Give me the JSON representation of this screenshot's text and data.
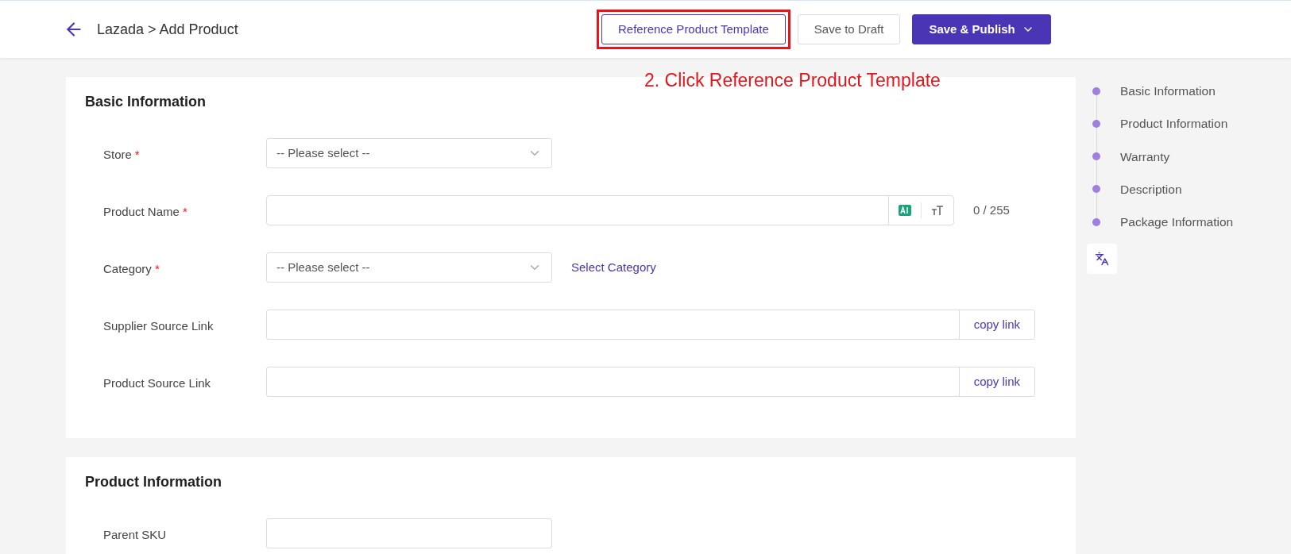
{
  "header": {
    "title": "Lazada > Add Product",
    "buttons": [
      {
        "label": "Reference Product Template",
        "kind": "outline",
        "highlighted": true
      },
      {
        "label": "Save to Draft",
        "kind": "plain",
        "highlighted": false
      },
      {
        "label": "Save & Publish",
        "kind": "primary",
        "highlighted": false
      }
    ]
  },
  "annotation": {
    "text": "2. Click Reference Product Template"
  },
  "sections": [
    {
      "title": "Basic Information",
      "fields": [
        {
          "label": "Store",
          "required_mark": "*",
          "kind": "select",
          "placeholder": "-- Please select --"
        },
        {
          "label": "Product Name",
          "required_mark": "*",
          "kind": "text-ai",
          "counter": "0 / 255"
        },
        {
          "label": "Category",
          "required_mark": "*",
          "kind": "select",
          "placeholder": "-- Please select --",
          "link": "Select Category"
        },
        {
          "label": "Supplier Source Link",
          "kind": "link-input",
          "button": "copy link"
        },
        {
          "label": "Product Source Link",
          "kind": "link-input",
          "button": "copy link"
        }
      ]
    },
    {
      "title": "Product Information",
      "fields": [
        {
          "label": "Parent SKU",
          "kind": "text"
        }
      ]
    }
  ],
  "nav": [
    {
      "label": "Basic Information"
    },
    {
      "label": "Product Information"
    },
    {
      "label": "Warranty"
    },
    {
      "label": "Description"
    },
    {
      "label": "Package Information"
    }
  ]
}
